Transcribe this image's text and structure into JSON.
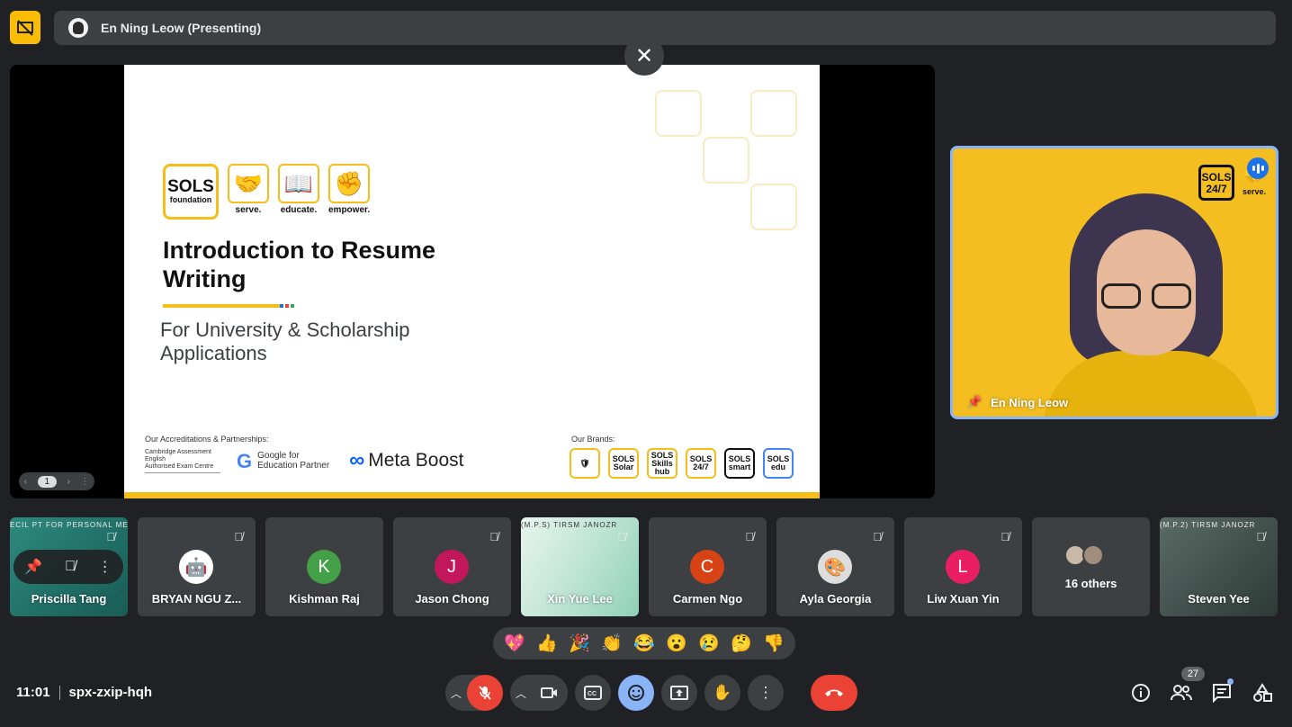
{
  "header": {
    "presenting_label": "En Ning Leow (Presenting)",
    "present_badge_icon": "presentation-off-icon"
  },
  "slide": {
    "logo_main": "SOLS",
    "logo_main_sub": "foundation",
    "tags": [
      "serve.",
      "educate.",
      "empower."
    ],
    "title": "Introduction to Resume Writing",
    "subtitle": "For University & Scholarship Applications",
    "accreditations_label": "Our Accreditations & Partnerships:",
    "cambridge_text": "Cambridge Assessment English",
    "cambridge_sub": "Authorised Exam Centre",
    "google_text": "Google for Education Partner",
    "meta_text": "Meta Boost",
    "brands_label": "Our Brands:",
    "brands": [
      "SOLS Solar",
      "SOLS Skills hub",
      "SOLS 24/7",
      "SOLS smart",
      "SOLS edu"
    ],
    "page_indicator": "1"
  },
  "presenter": {
    "name": "En Ning Leow",
    "corner_logo": "SOLS 24/7",
    "corner_tag": "serve."
  },
  "participants": [
    {
      "name": "Priscilla Tang",
      "type": "video-green",
      "banner": "ECIL PT FOR PERSONAL MERIT (S.P.M)"
    },
    {
      "name": "BRYAN NGU Z...",
      "type": "pic"
    },
    {
      "name": "Kishman Raj",
      "type": "initial",
      "initial": "K",
      "color": "#43a047"
    },
    {
      "name": "Jason Chong",
      "type": "initial",
      "initial": "J",
      "color": "#c2185b"
    },
    {
      "name": "Xin Yue Lee",
      "type": "video-light",
      "banner": "(M.P.S) TIRSM JANOZR"
    },
    {
      "name": "Carmen Ngo",
      "type": "initial",
      "initial": "C",
      "color": "#d84315"
    },
    {
      "name": "Ayla Georgia",
      "type": "pic"
    },
    {
      "name": "Liw Xuan Yin",
      "type": "initial",
      "initial": "L",
      "color": "#e91e63"
    },
    {
      "name": "16 others",
      "type": "others"
    },
    {
      "name": "Steven Yee",
      "type": "video-dark",
      "banner": "(M.P.2) TIRSM JANOZR"
    }
  ],
  "reactions": [
    "💖",
    "👍",
    "🎉",
    "👏",
    "😂",
    "😮",
    "😢",
    "🤔",
    "👎"
  ],
  "footer": {
    "time": "11:01",
    "meeting_code": "spx-zxip-hqh",
    "participant_count": "27"
  }
}
